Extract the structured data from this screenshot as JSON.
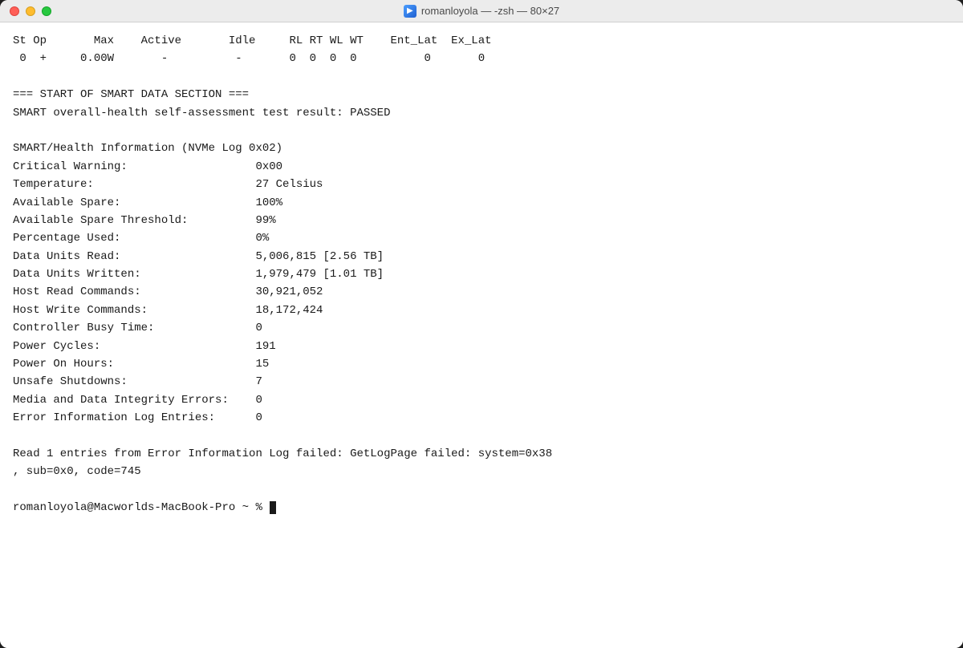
{
  "window": {
    "title": "romanloyola — -zsh — 80×27",
    "title_icon": "🖥"
  },
  "terminal": {
    "lines": [
      "St Op       Max    Active       Idle     RL RT WL WT    Ent_Lat  Ex_Lat",
      " 0  +     0.00W       -          -       0  0  0  0          0       0",
      "",
      "=== START OF SMART DATA SECTION ===",
      "SMART overall-health self-assessment test result: PASSED",
      "",
      "SMART/Health Information (NVMe Log 0x02)",
      "Critical Warning:                   0x00",
      "Temperature:                        27 Celsius",
      "Available Spare:                    100%",
      "Available Spare Threshold:          99%",
      "Percentage Used:                    0%",
      "Data Units Read:                    5,006,815 [2.56 TB]",
      "Data Units Written:                 1,979,479 [1.01 TB]",
      "Host Read Commands:                 30,921,052",
      "Host Write Commands:                18,172,424",
      "Controller Busy Time:               0",
      "Power Cycles:                       191",
      "Power On Hours:                     15",
      "Unsafe Shutdowns:                   7",
      "Media and Data Integrity Errors:    0",
      "Error Information Log Entries:      0",
      "",
      "Read 1 entries from Error Information Log failed: GetLogPage failed: system=0x38",
      ", sub=0x0, code=745",
      "",
      "romanloyola@Macworlds-MacBook-Pro ~ % "
    ],
    "prompt": "romanloyola@Macworlds-MacBook-Pro ~ % "
  }
}
